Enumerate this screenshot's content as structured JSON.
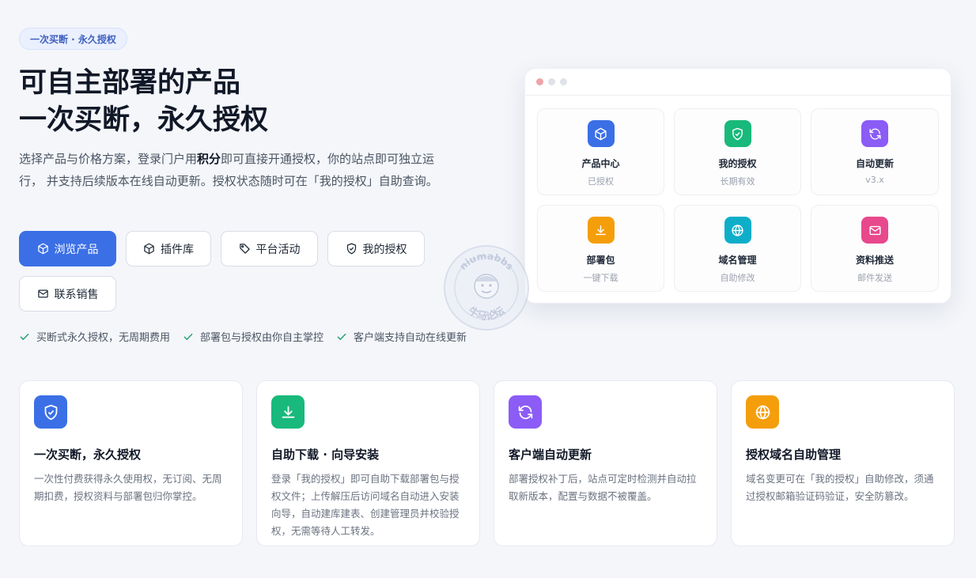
{
  "hero": {
    "badge": "一次买断 · 永久授权",
    "title_line1": "可自主部署的产品",
    "title_line2": "一次买断，永久授权",
    "desc_part1": "选择产品与价格方案，登录门户用",
    "desc_bold": "积分",
    "desc_part2": "即可直接开通授权，你的站点即可独立运行， 并支持后续版本在线自动更新。授权状态随时可在「我的授权」自助查询。"
  },
  "buttons": {
    "browse": "浏览产品",
    "plugins": "插件库",
    "events": "平台活动",
    "my_license": "我的授权",
    "contact": "联系销售"
  },
  "checks": [
    "买断式永久授权，无周期费用",
    "部署包与授权由你自主掌控",
    "客户端支持自动在线更新"
  ],
  "preview": {
    "tiles": [
      {
        "name": "产品中心",
        "sub": "已授权",
        "icon": "cube-icon",
        "color": "#3b6fe6"
      },
      {
        "name": "我的授权",
        "sub": "长期有效",
        "icon": "shield-check-icon",
        "color": "#18b97a"
      },
      {
        "name": "自动更新",
        "sub": "v3.x",
        "icon": "refresh-icon",
        "color": "#8b5cf6"
      },
      {
        "name": "部署包",
        "sub": "一键下载",
        "icon": "download-icon",
        "color": "#f59e0b"
      },
      {
        "name": "域名管理",
        "sub": "自助修改",
        "icon": "globe-icon",
        "color": "#0eaec9"
      },
      {
        "name": "资料推送",
        "sub": "邮件发送",
        "icon": "mail-icon",
        "color": "#e8488c"
      }
    ]
  },
  "watermark": {
    "top_text": "niumabbs",
    "bottom_text": "牛马论坛"
  },
  "cards": [
    {
      "title": "一次买断，永久授权",
      "text": "一次性付费获得永久使用权，无订阅、无周期扣费，授权资料与部署包归你掌控。",
      "icon": "shield-check-icon",
      "color": "#3b6fe6"
    },
    {
      "title": "自助下载 · 向导安装",
      "text": "登录「我的授权」即可自助下载部署包与授权文件；上传解压后访问域名自动进入安装向导，自动建库建表、创建管理员并校验授权，无需等待人工转发。",
      "icon": "download-icon",
      "color": "#18b97a"
    },
    {
      "title": "客户端自动更新",
      "text": "部署授权补丁后，站点可定时检测并自动拉取新版本，配置与数据不被覆盖。",
      "icon": "refresh-icon",
      "color": "#8b5cf6"
    },
    {
      "title": "授权域名自助管理",
      "text": "域名变更可在「我的授权」自助修改，须通过授权邮箱验证码验证，安全防篡改。",
      "icon": "globe-icon",
      "color": "#f59e0b"
    }
  ]
}
